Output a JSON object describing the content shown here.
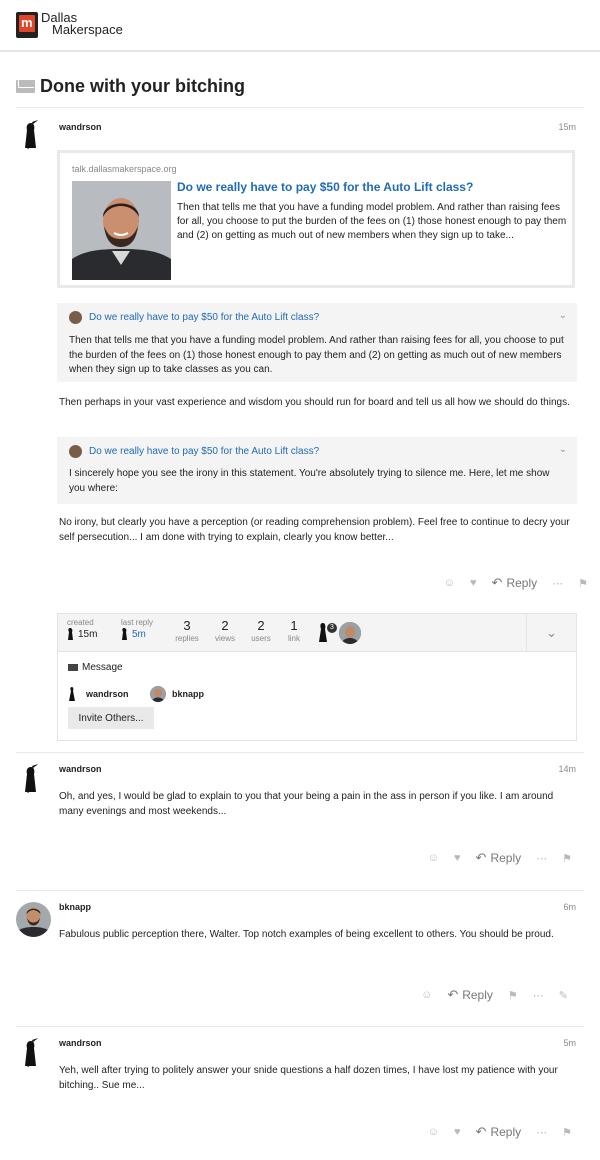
{
  "site": {
    "logo_line1": "Dallas",
    "logo_line2": "Makerspace"
  },
  "topic": {
    "title": "Done with your bitching"
  },
  "posts": [
    {
      "username": "wandrson",
      "time": "15m",
      "onebox": {
        "source": "talk.dallasmakerspace.org",
        "title": "Do we really have to pay $50 for the Auto Lift class?",
        "excerpt": "Then that tells me that you have a funding model problem. And rather than raising fees for all, you choose to put the burden of the fees on (1) those honest enough to pay them and (2) on getting as much out of new members when they sign up to take..."
      },
      "quote1": {
        "title": "Do we really have to pay $50 for the Auto Lift class?",
        "text": "Then that tells me that you have a funding model problem. And rather than raising fees for all, you choose to put the burden of the fees on (1) those honest enough to pay them and (2) on getting as much out of new members when they sign up to take classes as you can."
      },
      "para1": "Then perhaps in your vast experience and wisdom you should run for board and tell us all how we should do things.",
      "quote2": {
        "title": "Do we really have to pay $50 for the Auto Lift class?",
        "text": "I sincerely hope you see the irony in this statement. You're absolutely trying to silence me. Here, let me show you where:"
      },
      "para2": "No irony, but clearly you have a perception (or reading comprehension problem). Feel free to continue to decry your self persecution... I am done with trying to explain, clearly you know better...",
      "reply_label": "Reply"
    },
    {
      "username": "wandrson",
      "time": "14m",
      "text": "Oh, and yes, I would be glad to explain to you that your being a pain in the ass in person if you like. I am around many evenings and most weekends...",
      "reply_label": "Reply"
    },
    {
      "username": "bknapp",
      "time": "6m",
      "text": "Fabulous public perception there, Walter. Top notch examples of being excellent to others. You should be proud.",
      "reply_label": "Reply"
    },
    {
      "username": "wandrson",
      "time": "5m",
      "text": "Yeh, well after trying to politely answer your snide questions a half dozen times, I have lost my patience with your bitching.. Sue me...",
      "reply_label": "Reply"
    }
  ],
  "topic_map": {
    "created_label": "created",
    "created_time": "15m",
    "last_reply_label": "last reply",
    "last_reply_time": "5m",
    "replies_count": "3",
    "replies_label": "replies",
    "views_count": "2",
    "views_label": "views",
    "users_count": "2",
    "users_label": "users",
    "links_count": "1",
    "links_label": "link",
    "avatar_badge": "3",
    "message_label": "Message",
    "participants": [
      "wandrson",
      "bknapp"
    ],
    "invite_label": "Invite Others..."
  },
  "colors": {
    "link": "#1f6bb5",
    "separator": "#e9e9e9",
    "quote_bg": "#f4f4f4"
  }
}
